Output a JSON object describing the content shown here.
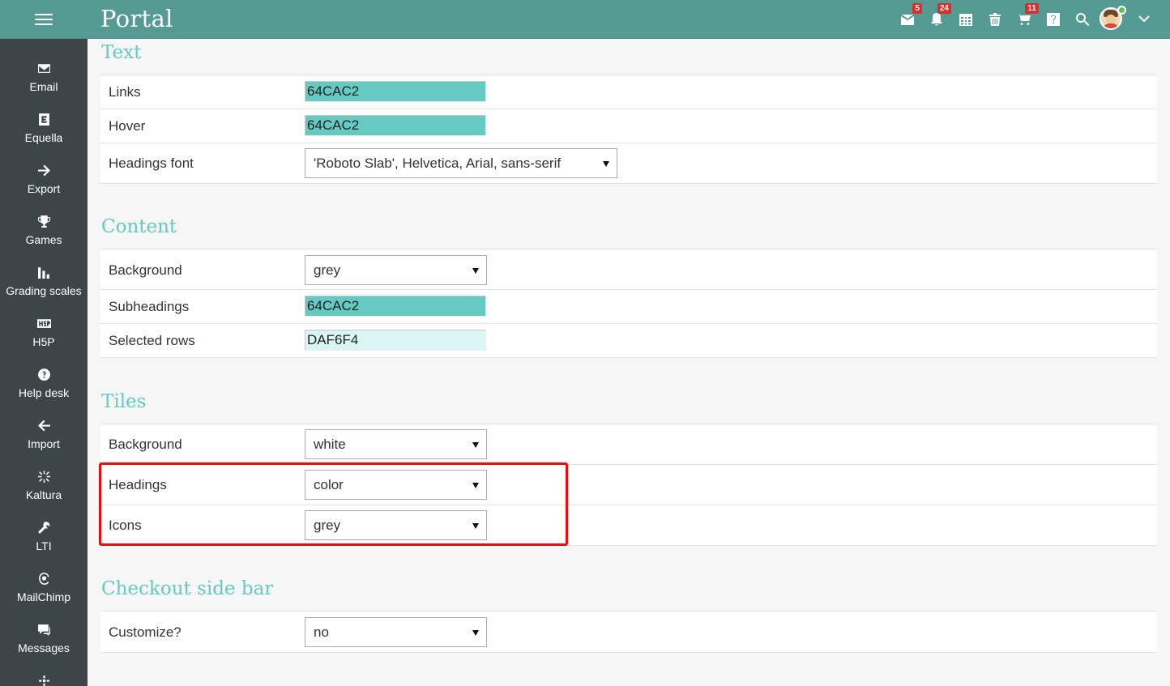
{
  "app": {
    "title": "Portal"
  },
  "header": {
    "icons": [
      {
        "name": "messages-icon",
        "badge": "5"
      },
      {
        "name": "notifications-icon",
        "badge": "24"
      },
      {
        "name": "calendar-icon",
        "badge": ""
      },
      {
        "name": "trash-icon",
        "badge": ""
      },
      {
        "name": "cart-icon",
        "badge": "11"
      },
      {
        "name": "help-icon",
        "badge": ""
      },
      {
        "name": "search-icon",
        "badge": ""
      }
    ]
  },
  "sidebar": {
    "items": [
      {
        "label": "Email",
        "icon": "envelope-icon"
      },
      {
        "label": "Equella",
        "icon": "equella-icon"
      },
      {
        "label": "Export",
        "icon": "arrow-right-icon"
      },
      {
        "label": "Games",
        "icon": "trophy-icon"
      },
      {
        "label": "Grading scales",
        "icon": "bar-chart-icon"
      },
      {
        "label": "H5P",
        "icon": "h5p-icon"
      },
      {
        "label": "Help desk",
        "icon": "question-circle-icon"
      },
      {
        "label": "Import",
        "icon": "arrow-left-icon"
      },
      {
        "label": "Kaltura",
        "icon": "sparkle-icon"
      },
      {
        "label": "LTI",
        "icon": "wrench-icon"
      },
      {
        "label": "MailChimp",
        "icon": "mailchimp-icon"
      },
      {
        "label": "Messages",
        "icon": "chat-icon"
      },
      {
        "label": "",
        "icon": "more-icon"
      }
    ]
  },
  "sections": {
    "text": {
      "title": "Text",
      "links_label": "Links",
      "links_value": "64CAC2",
      "hover_label": "Hover",
      "hover_value": "64CAC2",
      "headings_font_label": "Headings font",
      "headings_font_value": "'Roboto Slab', Helvetica, Arial, sans-serif"
    },
    "content": {
      "title": "Content",
      "background_label": "Background",
      "background_value": "grey",
      "subheadings_label": "Subheadings",
      "subheadings_value": "64CAC2",
      "selected_rows_label": "Selected rows",
      "selected_rows_value": "DAF6F4"
    },
    "tiles": {
      "title": "Tiles",
      "background_label": "Background",
      "background_value": "white",
      "headings_label": "Headings",
      "headings_value": "color",
      "icons_label": "Icons",
      "icons_value": "grey"
    },
    "checkout": {
      "title": "Checkout side bar",
      "customize_label": "Customize?",
      "customize_value": "no"
    }
  },
  "colors": {
    "topbar": "#559b94",
    "sidebar": "#3d4548",
    "accent": "#64cac2",
    "swatch_primary": "#64CAC2",
    "swatch_selected_rows": "#DAF6F4",
    "highlight": "#e80f0f"
  }
}
